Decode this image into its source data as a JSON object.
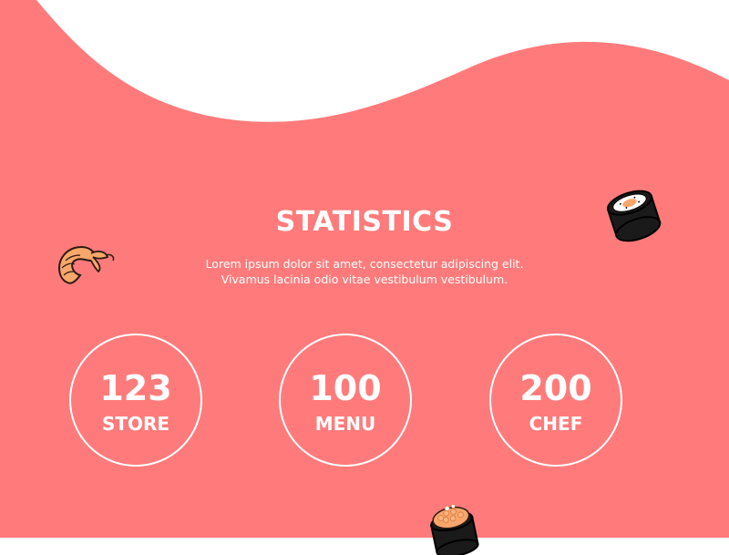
{
  "section": {
    "title": "STATISTICS",
    "description_line1": "Lorem ipsum dolor sit amet, consectetur adipiscing elit.",
    "description_line2": "Vivamus lacinia odio vitae vestibulum vestibulum."
  },
  "stats": [
    {
      "number": "123",
      "label": "STORE"
    },
    {
      "number": "100",
      "label": "MENU"
    },
    {
      "number": "200",
      "label": "CHEF"
    }
  ],
  "decorations": [
    "shrimp-icon",
    "sushi-roll-icon",
    "gunkan-sushi-icon"
  ],
  "colors": {
    "background": "#ff7b7b",
    "text": "#ffffff",
    "salmon": "#f9a66b",
    "nori": "#1a1a1a"
  }
}
